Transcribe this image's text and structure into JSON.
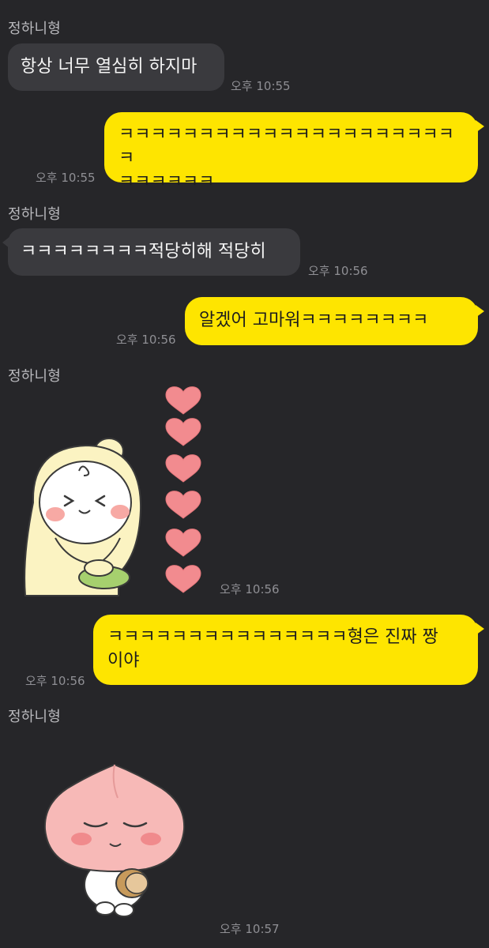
{
  "colors": {
    "background": "#262629",
    "incoming_bubble": "#3a3a3e",
    "outgoing_bubble": "#fee500",
    "timestamp": "#8f8f94"
  },
  "messages": [
    {
      "direction": "incoming",
      "sender": "정하니형",
      "text": "항상 너무 열심히 하지마",
      "time": "오후 10:55"
    },
    {
      "direction": "outgoing",
      "text_line1": "ㅋㅋㅋㅋㅋㅋㅋㅋㅋㅋㅋㅋㅋㅋㅋㅋㅋㅋㅋㅋㅋㅋ",
      "text_line2": "ㅋㅋㅋㅋㅋㅋ",
      "time": "오후 10:55"
    },
    {
      "direction": "incoming",
      "sender": "정하니형",
      "text": "ㅋㅋㅋㅋㅋㅋㅋㅋ적당히해 적당히",
      "time": "오후 10:56"
    },
    {
      "direction": "outgoing",
      "text": "알겠어 고마워ㅋㅋㅋㅋㅋㅋㅋㅋ",
      "time": "오후 10:56"
    },
    {
      "direction": "incoming",
      "sender": "정하니형",
      "sticker": "bear-hoodie-hearts-sticker",
      "time": "오후 10:56"
    },
    {
      "direction": "outgoing",
      "text_line1": "ㅋㅋㅋㅋㅋㅋㅋㅋㅋㅋㅋㅋㅋㅋㅋ형은 진짜 짱",
      "text_line2": "이야",
      "time": "오후 10:56"
    },
    {
      "direction": "incoming",
      "sender": "정하니형",
      "sticker": "peach-character-sticker",
      "time": "오후 10:57"
    }
  ]
}
